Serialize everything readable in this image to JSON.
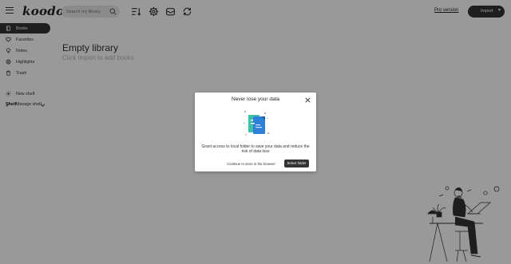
{
  "header": {
    "logo": "koodo",
    "search_placeholder": "Search my library",
    "pro_version": "Pro version",
    "import_label": "Import"
  },
  "sidebar": {
    "items": [
      {
        "label": "Books",
        "icon": "book-icon",
        "active": true
      },
      {
        "label": "Favorites",
        "icon": "heart-icon",
        "active": false
      },
      {
        "label": "Notes",
        "icon": "lightbulb-icon",
        "active": false
      },
      {
        "label": "Highlights",
        "icon": "highlight-icon",
        "active": false
      },
      {
        "label": "Trash",
        "icon": "trash-icon",
        "active": false
      }
    ],
    "shelf_title": "Shelf",
    "new_shelf": "New shelf",
    "manage_shelf": "Manage shelf"
  },
  "main": {
    "empty_title": "Empty library",
    "empty_subtitle": "Click import to add books"
  },
  "dialog": {
    "title": "Never lose your data",
    "message": "Grant access to local folder to save your data and reduce the risk of data loss",
    "continue_label": "Continue to store in the browser",
    "select_label": "Select folder"
  },
  "colors": {
    "accent_dark": "#333333",
    "overlay": "rgba(0,0,0,0.4)",
    "doc_teal": "#3ec0a8",
    "doc_blue": "#2f80d8"
  }
}
